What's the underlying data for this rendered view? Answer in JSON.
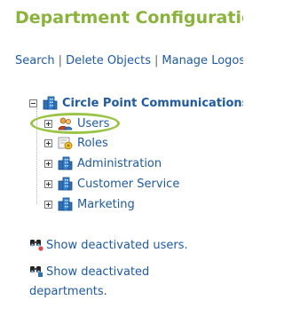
{
  "page": {
    "title": "Department Configuration"
  },
  "actions": {
    "search": "Search",
    "delete_objects": "Delete Objects",
    "manage_logos": "Manage Logos",
    "separator": "|"
  },
  "tree": {
    "root": "Circle Point Communications",
    "children": [
      {
        "label": "Users",
        "icon": "users-icon"
      },
      {
        "label": "Roles",
        "icon": "roles-icon"
      },
      {
        "label": "Administration",
        "icon": "department-icon"
      },
      {
        "label": "Customer Service",
        "icon": "department-icon"
      },
      {
        "label": "Marketing",
        "icon": "department-icon"
      }
    ]
  },
  "links": {
    "deactivated_users": "Show deactivated users.",
    "deactivated_departments_line1": "Show deactivated",
    "deactivated_departments_line2": "departments."
  },
  "colors": {
    "title": "#8ab33c",
    "link": "#1f5aa0",
    "highlight": "#9ac447"
  }
}
